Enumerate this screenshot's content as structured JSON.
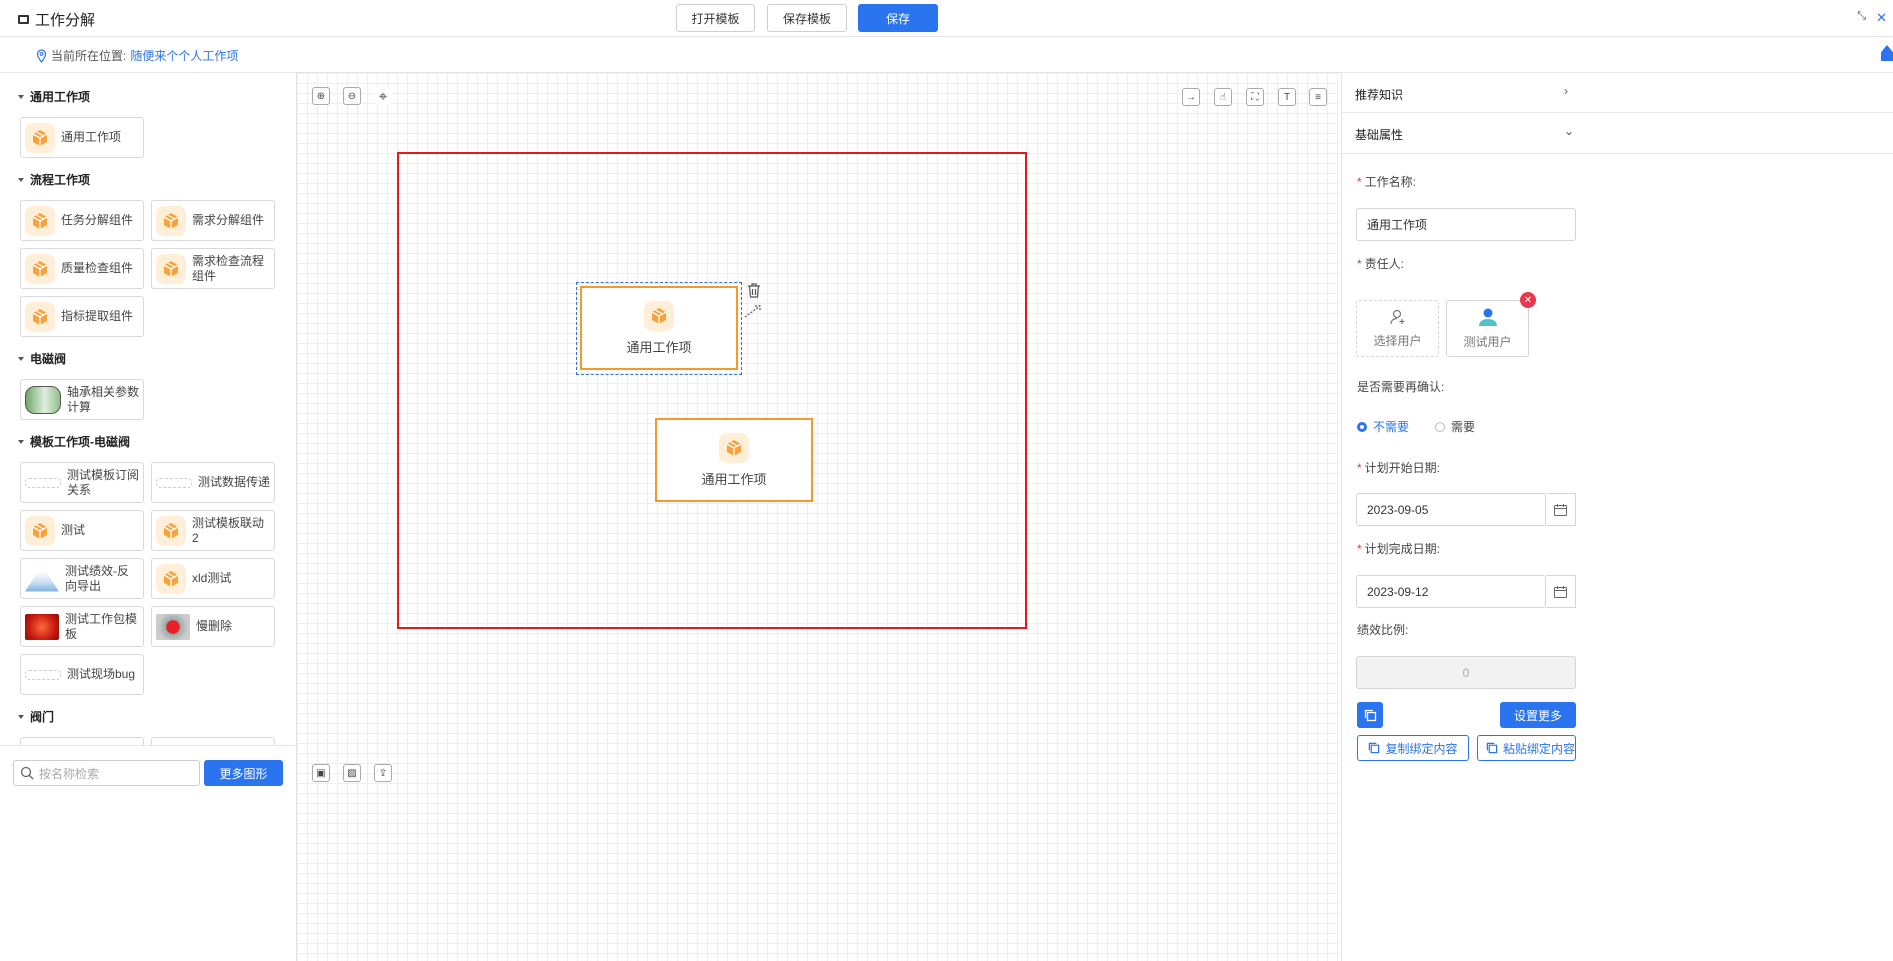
{
  "header": {
    "title": "工作分解",
    "open_template": "打开模板",
    "save_template": "保存模板",
    "save": "保存"
  },
  "location": {
    "prefix": "当前所在位置:",
    "link": "随便来个个人工作项"
  },
  "palette": {
    "groups": [
      {
        "title": "通用工作项",
        "items": [
          "通用工作项"
        ]
      },
      {
        "title": "流程工作项",
        "items": [
          "任务分解组件",
          "需求分解组件",
          "质量检查组件",
          "需求检查流程组件",
          "指标提取组件"
        ]
      },
      {
        "title": "电磁阀",
        "items": [
          "轴承相关参数计算"
        ]
      },
      {
        "title": "模板工作项-电磁阀",
        "items": [
          "测试模板订阅关系",
          "测试数据传递",
          "测试",
          "测试模板联动2",
          "测试绩效-反向导出",
          "xld测试",
          "测试工作包模板",
          "慢删除",
          "测试现场bug"
        ]
      },
      {
        "title": "阀门",
        "items": []
      }
    ],
    "search_placeholder": "按名称检索",
    "more_shapes": "更多图形"
  },
  "canvas": {
    "nodes": [
      {
        "label": "通用工作项",
        "selected": true
      },
      {
        "label": "通用工作项",
        "selected": false
      }
    ]
  },
  "properties": {
    "recommend_title": "推荐知识",
    "basic_title": "基础属性",
    "work_name_label": "工作名称:",
    "work_name_value": "通用工作项",
    "owner_label": "责任人:",
    "select_user": "选择用户",
    "assigned_user": "测试用户",
    "confirm_label": "是否需要再确认:",
    "confirm_options": [
      "不需要",
      "需要"
    ],
    "confirm_selected": "不需要",
    "start_label": "计划开始日期:",
    "start_value": "2023-09-05",
    "end_label": "计划完成日期:",
    "end_value": "2023-09-12",
    "ratio_label": "绩效比例:",
    "ratio_value": "0",
    "set_more": "设置更多",
    "copy_bind": "复制绑定内容",
    "paste_bind": "粘贴绑定内容"
  },
  "colors": {
    "primary": "#2a74f0",
    "node_border": "#f29a2e",
    "frame": "#e41a1a",
    "delete_badge": "#e8384f"
  }
}
